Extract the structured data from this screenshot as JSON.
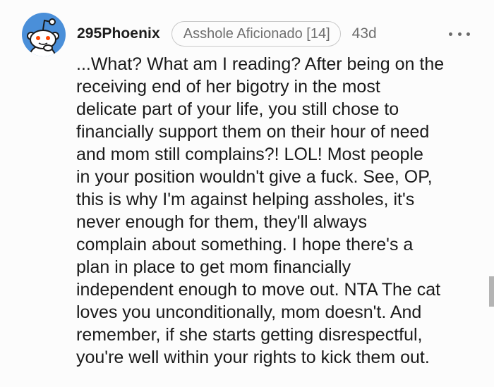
{
  "comment": {
    "username": "295Phoenix",
    "flair": "Asshole Aficionado [14]",
    "age": "43d",
    "more_icon": "more-horizontal-icon",
    "avatar_icon": "reddit-snoo-avatar-icon",
    "body_lines": [
      "...What? What am I reading? After being on the",
      "receiving end of her bigotry in the most",
      "delicate part of your life, you still chose to",
      "financially support them on their hour of need",
      "and mom still complains?! LOL! Most people",
      "in your position wouldn't give a fuck. See, OP,",
      "this is why I'm against helping assholes, it's",
      "never enough for them, they'll always",
      "complain about something. I hope there's a",
      "plan in place to get mom financially",
      "independent enough to move out. NTA The cat",
      "loves you unconditionally, mom doesn't. And",
      "remember, if she starts getting disrespectful,",
      "you're well within your rights to kick them out."
    ]
  },
  "colors": {
    "background": "#fcfcfc",
    "avatar_blue": "#4a8fd9",
    "text": "#1a1a1a",
    "meta_gray": "#6f6f6f"
  }
}
